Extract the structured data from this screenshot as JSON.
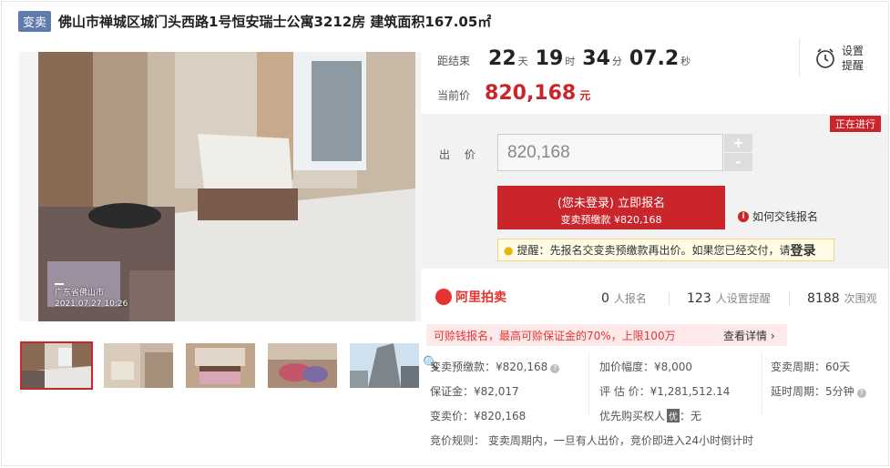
{
  "header": {
    "tag": "变卖",
    "title": "佛山市禅城区城门头西路1号恒安瑞士公寓3212房 建筑面积167.05㎡"
  },
  "photo": {
    "watermark_line1": "广东省佛山市",
    "watermark_line2": "2021.07.27 10:26"
  },
  "countdown": {
    "label": "距结束",
    "days": "22",
    "days_unit": "天",
    "hours": "19",
    "hours_unit": "时",
    "minutes": "34",
    "minutes_unit": "分",
    "seconds": "07.2",
    "seconds_unit": "秒"
  },
  "current_price": {
    "label": "当前价",
    "value": "820,168",
    "unit": "元"
  },
  "reminder": {
    "label": "设置提醒"
  },
  "bid": {
    "status": "正在进行",
    "label": "出 价",
    "input_value": "820,168",
    "plus": "+",
    "minus": "-",
    "register_line1": "(您未登录) 立即报名",
    "register_line2": "变卖预缴款 ¥820,168",
    "how_pay": "如何交钱报名",
    "tip_text": "提醒：先报名交变卖预缴款再出价。如果您已经交付，请",
    "tip_login": "登录"
  },
  "stats": {
    "logo_text": "阿里拍卖",
    "signups": "0",
    "signups_label": "人报名",
    "reminders": "123",
    "reminders_label": "人设置提醒",
    "views": "8188",
    "views_label": "次围观"
  },
  "promo": {
    "message": "可赊钱报名，最高可赊保证金的70%，上限100万",
    "detail": "查看详情 ›"
  },
  "details": {
    "deposit_pre": "变卖预缴款：¥820,168",
    "margin": "保证金：¥82,017",
    "sale_deposit": "变卖价：¥820,168",
    "increment": "加价幅度：¥8,000",
    "appraisal": "评 估 价：¥1,281,512.14",
    "priority_buyer_label": "优先购买权人",
    "priority_buyer_badge": "优",
    "priority_buyer_value": "：无",
    "period": "变卖周期：60天",
    "delay": "延时周期：5分钟",
    "rule": "竞价规则：  变卖周期内，一旦有人出价，竞价即进入24小时倒计时"
  },
  "colors": {
    "accent": "#c9252b",
    "tag_bg": "#5f7cad",
    "promo_bg": "#fde9ea"
  }
}
